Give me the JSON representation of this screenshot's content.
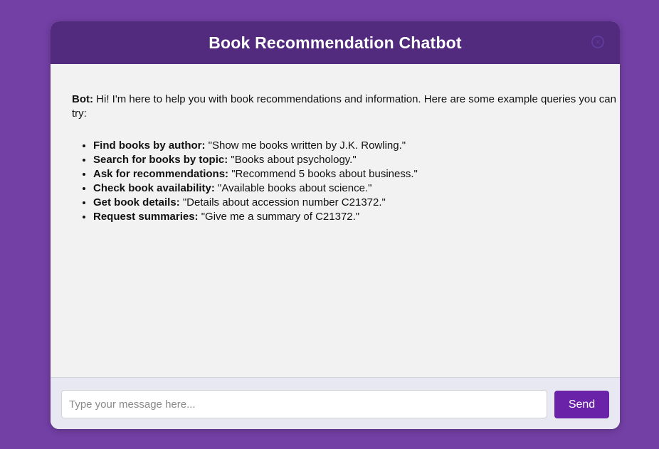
{
  "header": {
    "title": "Book Recommendation Chatbot",
    "close_icon": "close-icon"
  },
  "chat": {
    "bot_label": "Bot:",
    "bot_intro": " Hi! I'm here to help you with book recommendations and information. Here are some example queries you can try:",
    "queries": [
      {
        "label": "Find books by author:",
        "example": " \"Show me books written by J.K. Rowling.\""
      },
      {
        "label": "Search for books by topic:",
        "example": " \"Books about psychology.\""
      },
      {
        "label": "Ask for recommendations:",
        "example": " \"Recommend 5 books about business.\""
      },
      {
        "label": "Check book availability:",
        "example": " \"Available books about science.\""
      },
      {
        "label": "Get book details:",
        "example": " \"Details about accession number C21372.\""
      },
      {
        "label": "Request summaries:",
        "example": " \"Give me a summary of C21372.\""
      }
    ]
  },
  "input": {
    "placeholder": "Type your message here...",
    "value": "",
    "send_label": "Send"
  },
  "colors": {
    "page_background": "#7340a6",
    "header_background": "#522b7e",
    "send_button": "#6a22a8"
  }
}
